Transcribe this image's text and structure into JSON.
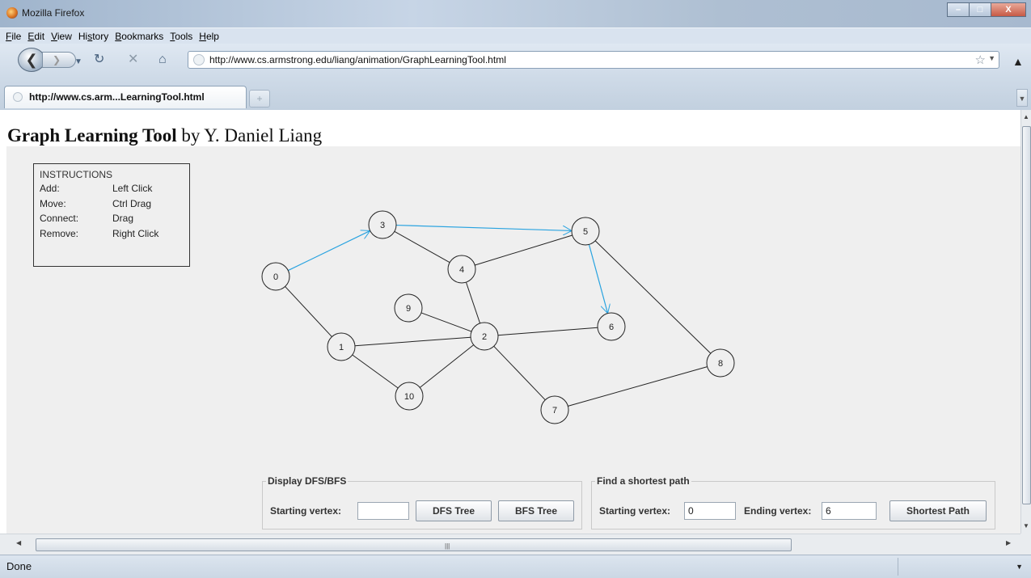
{
  "window": {
    "title": "Mozilla Firefox",
    "minimize": "–",
    "maximize": "□",
    "close": "X"
  },
  "menu": [
    "File",
    "Edit",
    "View",
    "History",
    "Bookmarks",
    "Tools",
    "Help"
  ],
  "menu_mnemonics": [
    "F",
    "E",
    "V",
    "s",
    "B",
    "T",
    "H"
  ],
  "address": {
    "url": "http://www.cs.armstrong.edu/liang/animation/GraphLearningTool.html"
  },
  "tab": {
    "label": "http://www.cs.arm...LearningTool.html",
    "new_tab": "+"
  },
  "page": {
    "title_bold": "Graph Learning Tool",
    "title_rest": " by Y. Daniel Liang"
  },
  "instructions": {
    "title": "INSTRUCTIONS",
    "rows": [
      {
        "action": "Add:",
        "gesture": "Left Click"
      },
      {
        "action": "Move:",
        "gesture": "Ctrl Drag"
      },
      {
        "action": "Connect:",
        "gesture": "Drag"
      },
      {
        "action": "Remove:",
        "gesture": "Right Click"
      }
    ]
  },
  "graph": {
    "vertices": [
      "0",
      "1",
      "2",
      "3",
      "4",
      "5",
      "6",
      "7",
      "8",
      "9",
      "10"
    ],
    "edges": [
      {
        "from": "0",
        "to": "1"
      },
      {
        "from": "1",
        "to": "2"
      },
      {
        "from": "1",
        "to": "10"
      },
      {
        "from": "10",
        "to": "2"
      },
      {
        "from": "9",
        "to": "2"
      },
      {
        "from": "2",
        "to": "4"
      },
      {
        "from": "3",
        "to": "4"
      },
      {
        "from": "4",
        "to": "5"
      },
      {
        "from": "2",
        "to": "6"
      },
      {
        "from": "2",
        "to": "7"
      },
      {
        "from": "7",
        "to": "8"
      },
      {
        "from": "5",
        "to": "8"
      }
    ],
    "path_edges": [
      {
        "from": "0",
        "to": "3"
      },
      {
        "from": "3",
        "to": "5"
      },
      {
        "from": "5",
        "to": "6"
      }
    ],
    "path_color": "#29a3e0"
  },
  "dfsbfs": {
    "group_label": "Display DFS/BFS",
    "start_label": "Starting vertex:",
    "start_value": "",
    "dfs_button": "DFS Tree",
    "bfs_button": "BFS Tree"
  },
  "shortest": {
    "group_label": "Find a shortest path",
    "start_label": "Starting vertex:",
    "start_value": "0",
    "end_label": "Ending vertex:",
    "end_value": "6",
    "button": "Shortest Path"
  },
  "status": {
    "text": "Done"
  }
}
